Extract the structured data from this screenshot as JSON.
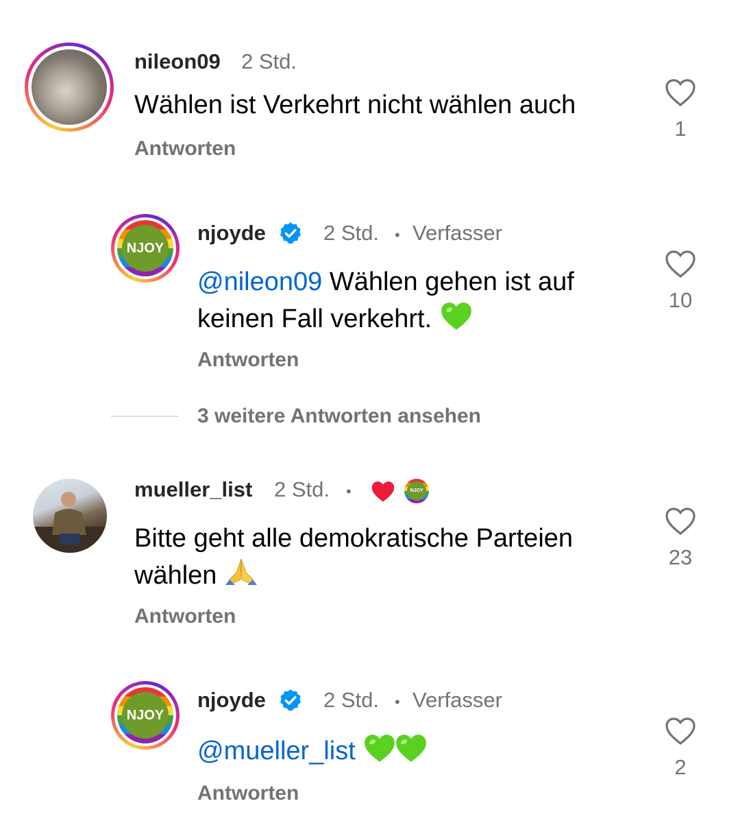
{
  "comments": [
    {
      "username": "nileon09",
      "time": "2 Std.",
      "text": "Wählen ist Verkehrt nicht wählen auch",
      "reply_label": "Antworten",
      "like_count": "1"
    },
    {
      "username": "njoyde",
      "verified": true,
      "time": "2 Std.",
      "author_label": "Verfasser",
      "mention": "@nileon09",
      "text_line1": " Wählen gehen ist auf",
      "text_line2": "keinen Fall verkehrt.",
      "emoji": "green-heart",
      "reply_label": "Antworten",
      "like_count": "10",
      "avatar_text": "NJOY"
    },
    {
      "username": "mueller_list",
      "time": "2 Std.",
      "text_line1": "Bitte geht alle demokratische Parteien",
      "text_line2": "wählen",
      "emoji": "folded-hands",
      "liked_by_author": true,
      "reply_label": "Antworten",
      "like_count": "23",
      "mini_avatar_text": "NJOY"
    },
    {
      "username": "njoyde",
      "verified": true,
      "time": "2 Std.",
      "author_label": "Verfasser",
      "mention": "@mueller_list",
      "emoji": "green-heart x2",
      "reply_label": "Antworten",
      "like_count": "2",
      "avatar_text": "NJOY"
    }
  ],
  "view_more_replies": "3 weitere Antworten ansehen",
  "colors": {
    "mention": "#0064d1",
    "secondary_text": "#737373",
    "green_heart": "#5ad121",
    "red_heart": "#ed1c3a"
  }
}
